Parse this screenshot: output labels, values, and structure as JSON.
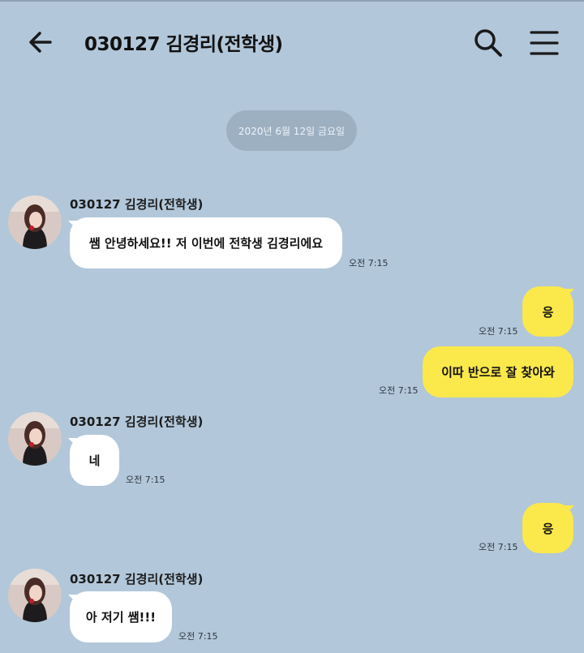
{
  "header": {
    "title": "030127 김경리(전학생)",
    "back_icon": "arrow-left-icon",
    "search_icon": "search-icon",
    "menu_icon": "hamburger-menu-icon"
  },
  "date_divider": "2020년 6월 12일 금요일",
  "colors": {
    "background": "#b2c7da",
    "incoming_bubble": "#ffffff",
    "outgoing_bubble": "#fbe84b",
    "date_chip": "#9db0c2"
  },
  "messages": [
    {
      "direction": "incoming",
      "sender": "030127 김경리(전학생)",
      "text": "쌤 안녕하세요!! 저 이번에 전학생 김경리에요",
      "time": "오전 7:15"
    },
    {
      "direction": "outgoing",
      "text": "응",
      "time": "오전 7:15"
    },
    {
      "direction": "outgoing",
      "text": "이따 반으로 잘 찾아와",
      "time": "오전 7:15"
    },
    {
      "direction": "incoming",
      "sender": "030127 김경리(전학생)",
      "text": "네",
      "time": "오전 7:15"
    },
    {
      "direction": "outgoing",
      "text": "응",
      "time": "오전 7:15"
    },
    {
      "direction": "incoming",
      "sender": "030127 김경리(전학생)",
      "text": "아 저기 쌤!!!",
      "time": "오전 7:15"
    }
  ]
}
